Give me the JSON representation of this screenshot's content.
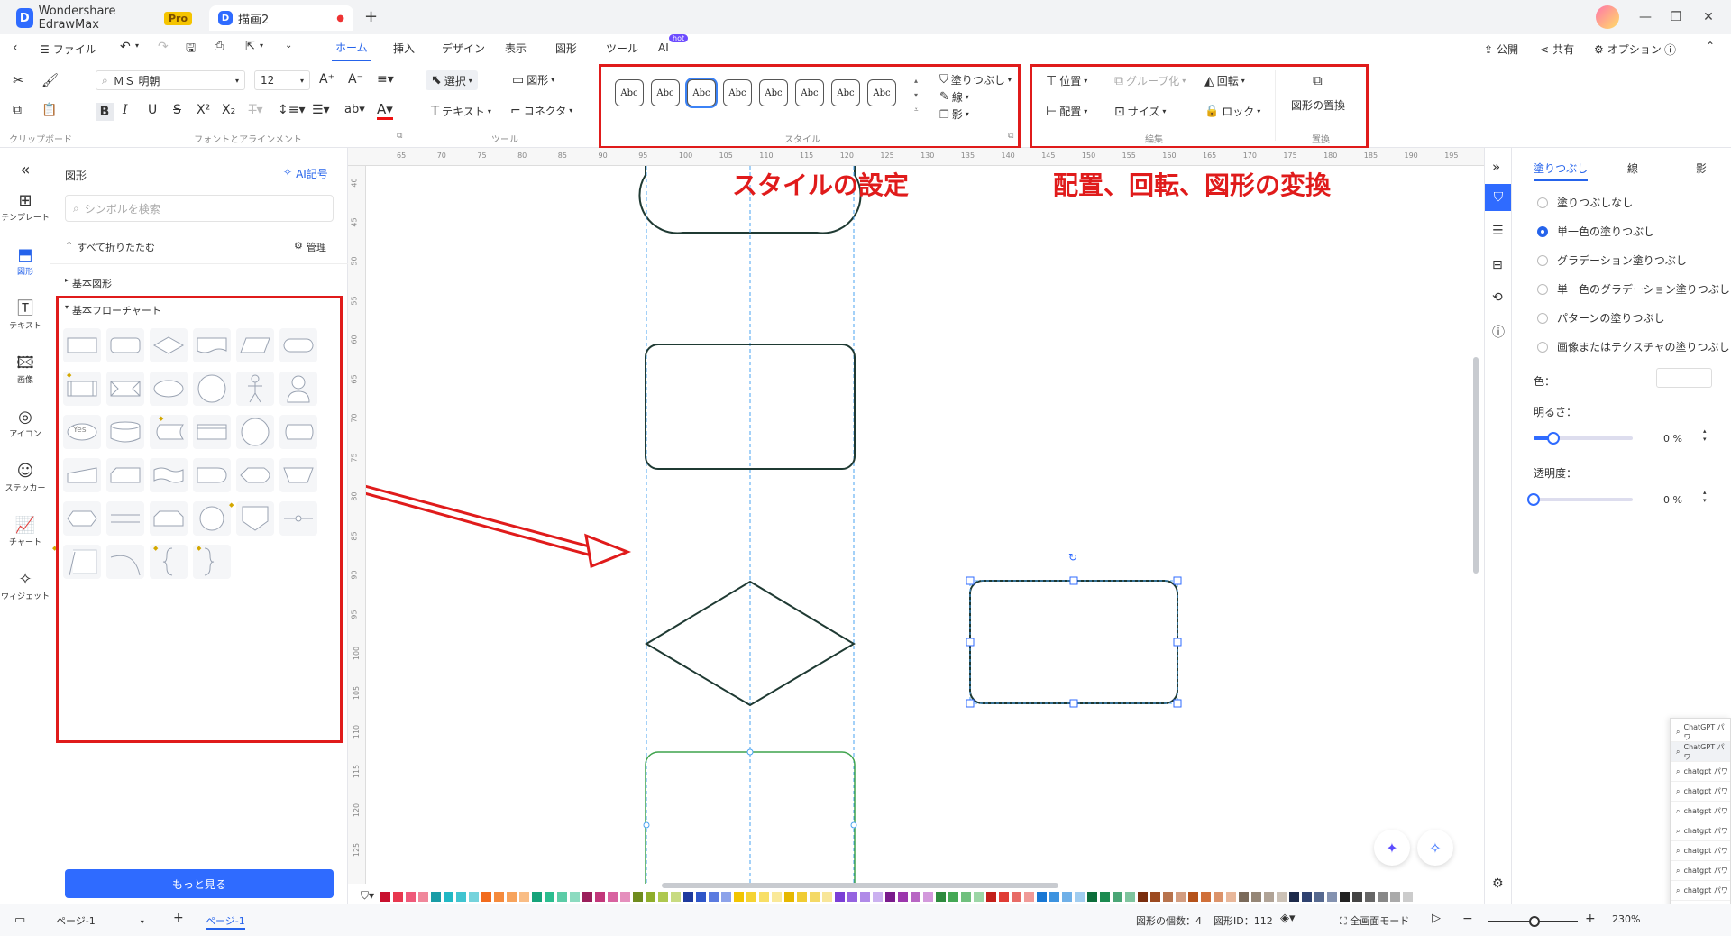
{
  "app": {
    "name": "Wondershare EdrawMax",
    "badge": "Pro",
    "doc_tab": "描画2"
  },
  "menu": {
    "file": "ファイル",
    "tabs": [
      "ホーム",
      "挿入",
      "デザイン",
      "表示",
      "図形",
      "ツール",
      "AI"
    ],
    "ai_badge": "hot",
    "right": [
      "公開",
      "共有",
      "オプション"
    ]
  },
  "ribbon": {
    "font_name": "ＭＳ 明朝",
    "font_size": "12",
    "select": "選択",
    "shape": "図形",
    "text": "テキスト",
    "connector": "コネクタ",
    "style_box": "Abc",
    "fill": "塗りつぶし",
    "line": "線",
    "shadow": "影",
    "position": "位置",
    "group": "グループ化",
    "rotate": "回転",
    "align": "配置",
    "size": "サイズ",
    "lock": "ロック",
    "replace": "図形の置換",
    "groups": {
      "clipboard": "クリップボード",
      "font": "フォントとアラインメント",
      "tools": "ツール",
      "style": "スタイル",
      "edit": "編集",
      "replace": "置換"
    }
  },
  "annotations": {
    "style": "スタイルの設定",
    "arrange": "配置、回転、図形の変換"
  },
  "leftnav": [
    "テンプレート",
    "図形",
    "テキスト",
    "画像",
    "アイコン",
    "ステッカー",
    "チャート",
    "ウィジェット"
  ],
  "panel": {
    "title": "図形",
    "ai": "AI記号",
    "search_placeholder": "シンボルを検索",
    "collapse_all": "すべて折りたたむ",
    "manage": "管理",
    "basic_shapes": "基本図形",
    "basic_flowchart": "基本フローチャート",
    "yes": "Yes",
    "more": "もっと見る"
  },
  "hruler_ticks": [
    "65",
    "70",
    "75",
    "80",
    "85",
    "90",
    "95",
    "100",
    "105",
    "110",
    "115",
    "120",
    "125",
    "130",
    "135",
    "140",
    "145",
    "150",
    "155",
    "160",
    "165",
    "170",
    "175",
    "180",
    "185",
    "190",
    "195",
    "200"
  ],
  "vruler_ticks": [
    "40",
    "45",
    "50",
    "55",
    "60",
    "65",
    "70",
    "75",
    "80",
    "85",
    "90",
    "95",
    "100",
    "105",
    "110",
    "115",
    "120",
    "125"
  ],
  "rpanel": {
    "tabs": [
      "塗りつぶし",
      "線",
      "影"
    ],
    "options": [
      "塗りつぶしなし",
      "単一色の塗りつぶし",
      "グラデーション塗りつぶし",
      "単一色のグラデーション塗りつぶし",
      "パターンの塗りつぶし",
      "画像またはテクスチャの塗りつぶし"
    ],
    "color_label": "色：",
    "brightness_label": "明るさ：",
    "brightness_value": "0 %",
    "brightness_fraction": 0.2,
    "transparency_label": "透明度：",
    "transparency_value": "0 %",
    "transparency_fraction": 0
  },
  "suggestions": [
    "ChatGPT パワ",
    "ChatGPT パワ",
    "chatgpt パワ",
    "chatgpt パワ",
    "chatgpt パワ",
    "chatgpt パワ",
    "chatgpt パワ",
    "chatgpt パワ",
    "chatgpt パワ",
    "chatgpt パワ"
  ],
  "status": {
    "page_select": "ページ-1",
    "page_tab": "ページ-1",
    "shape_count": "図形の個数：4",
    "shape_id": "図形ID：112",
    "fullscreen": "全画面モード",
    "zoom": "230%"
  },
  "colors": [
    "#c8102e",
    "#e8384f",
    "#ef5a7a",
    "#f0879b",
    "#199ca6",
    "#21b8c4",
    "#40c4d0",
    "#75d3dc",
    "#f26b1d",
    "#f58a3c",
    "#f7a35c",
    "#f9bd85",
    "#15a37a",
    "#2bbd8f",
    "#5ccca7",
    "#8cdbc0",
    "#9b1f5b",
    "#c2377a",
    "#d862a0",
    "#e58fbd",
    "#6f8c1e",
    "#8fae2b",
    "#aec84f",
    "#c8db80",
    "#1e3a9e",
    "#2f56c9",
    "#5b7be0",
    "#8ca2ea",
    "#f2c500",
    "#f5d333",
    "#f8df66",
    "#fae999",
    "#e6b800",
    "#f0cc33",
    "#f4d966",
    "#f8e699",
    "#7b3fd6",
    "#9563e0",
    "#b08ae8",
    "#cbb1f0",
    "#7a1b8c",
    "#9c37ad",
    "#b866c4",
    "#d399dc",
    "#2e8b3e",
    "#44a855",
    "#70c07e",
    "#9cd6a6",
    "#c4201b",
    "#e03c35",
    "#e86b66",
    "#f09a97",
    "#1877d4",
    "#3d93e0",
    "#6fb0e8",
    "#a1cdf0",
    "#0d6e3b",
    "#1c8a50",
    "#4aa676",
    "#7fc49e",
    "#7a2e0e",
    "#9c4a20",
    "#b8734d",
    "#d39d80",
    "#b5521a",
    "#d0703a",
    "#dc936a",
    "#e8b79a",
    "#7a6a5a",
    "#958676",
    "#b0a396",
    "#cbc1b6",
    "#1d2a4a",
    "#2f4270",
    "#56698f",
    "#8492b0",
    "#222222",
    "#444444",
    "#666666",
    "#888888",
    "#aaaaaa",
    "#cccccc"
  ]
}
